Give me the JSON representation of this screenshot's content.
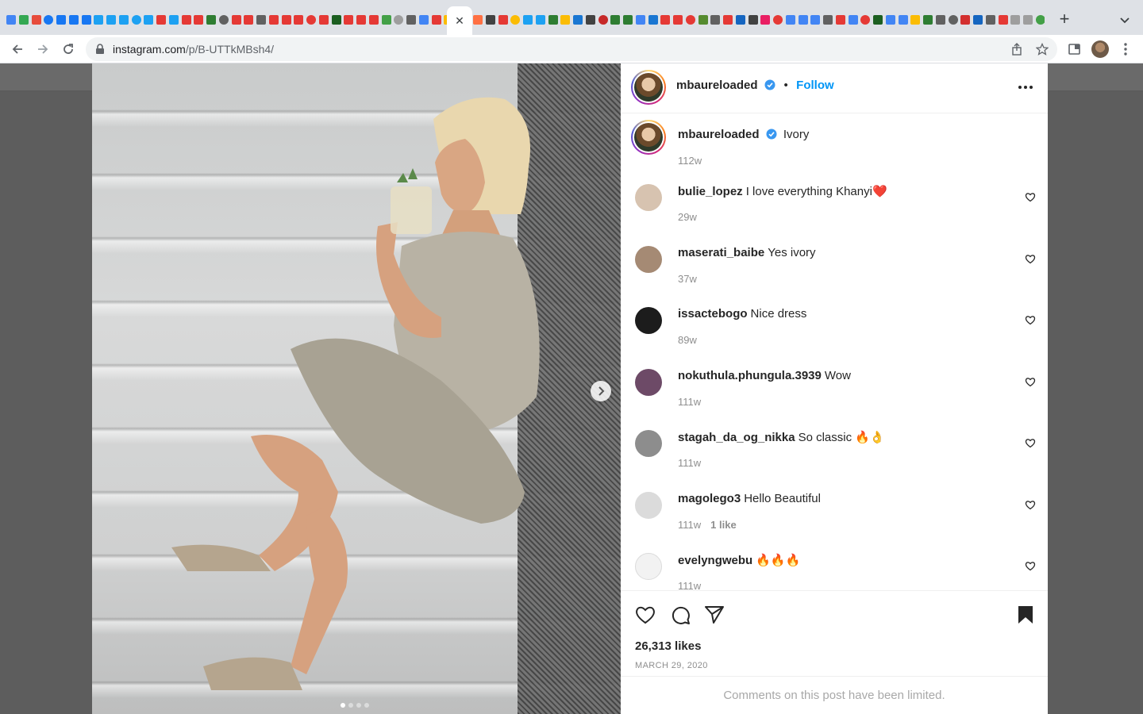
{
  "browser": {
    "favicon_colors": [
      "#4285f4",
      "#34a853",
      "#e74c3c",
      "#1877f2",
      "#1877f2",
      "#1877f2",
      "#1877f2",
      "#1da1f2",
      "#1da1f2",
      "#1da1f2",
      "#1da1f2",
      "#1da1f2",
      "#e53935",
      "#1da1f2",
      "#e53935",
      "#e53935",
      "#2e7d32",
      "#616161",
      "#e53935",
      "#e53935",
      "#616161",
      "#e53935",
      "#e53935",
      "#e53935",
      "#e53935",
      "#e53935",
      "#1b5e20",
      "#e53935",
      "#e53935",
      "#e53935",
      "#43a047",
      "#9e9e9e",
      "#616161",
      "#4285f4",
      "#e53935",
      "#fbbc04",
      "#1da1f2"
    ],
    "favicon_colors_right": [
      "#ff7043",
      "#424242",
      "#e53935",
      "#fbbc04",
      "#1da1f2",
      "#1da1f2",
      "#2e7d32",
      "#fbbc04",
      "#1976d2",
      "#424242",
      "#c62828",
      "#2e7d32",
      "#2e7d32",
      "#4285f4",
      "#1976d2",
      "#e53935",
      "#e53935",
      "#e53935",
      "#558b2f",
      "#616161",
      "#e53935",
      "#1565c0",
      "#424242",
      "#e91e63",
      "#e53935",
      "#4285f4",
      "#4285f4",
      "#4285f4",
      "#616161",
      "#e53935",
      "#4285f4",
      "#e53935",
      "#1b5e20",
      "#4285f4",
      "#4285f4",
      "#fbbc04",
      "#2e7d32",
      "#616161",
      "#616161",
      "#d32f2f",
      "#1565c0",
      "#616161",
      "#e53935",
      "#9e9e9e",
      "#9e9e9e",
      "#43a047",
      "#212121"
    ],
    "url_host": "instagram.com",
    "url_path": "/p/B-UTTkMBsh4/"
  },
  "post": {
    "author": "mbaureloaded",
    "follow_label": "Follow",
    "separator": "•",
    "caption": "Ivory",
    "caption_age": "112w",
    "likes": "26,313 likes",
    "date": "MARCH 29, 2020",
    "comments_limited": "Comments on this post have been limited.",
    "carousel_count": 4,
    "carousel_active": 0
  },
  "comments": [
    {
      "user": "bulie_lopez",
      "text": "I love everything Khanyi❤️",
      "age": "29w",
      "likes": "",
      "avatar_color": "#d7c3b0"
    },
    {
      "user": "maserati_baibe",
      "text": "Yes ivory",
      "age": "37w",
      "likes": "",
      "avatar_color": "#a58a74"
    },
    {
      "user": "issactebogo",
      "text": "Nice dress",
      "age": "89w",
      "likes": "",
      "avatar_color": "#1c1c1c"
    },
    {
      "user": "nokuthula.phungula.3939",
      "text": "Wow",
      "age": "111w",
      "likes": "",
      "avatar_color": "#6d4a67"
    },
    {
      "user": "stagah_da_og_nikka",
      "text": "So classic 🔥👌",
      "age": "111w",
      "likes": "",
      "avatar_color": "#8d8d8d"
    },
    {
      "user": "magolego3",
      "text": "Hello Beautiful",
      "age": "111w",
      "likes": "1 like",
      "avatar_color": "#dbdbdb"
    },
    {
      "user": "evelyngwebu",
      "text": "🔥🔥🔥",
      "age": "111w",
      "likes": "",
      "avatar_color": "#f2f2f2"
    }
  ],
  "colors": {
    "follow_blue": "#0095f6",
    "text_primary": "#262626",
    "text_secondary": "#8e8e8e"
  },
  "icons": [
    "lock-icon",
    "back-arrow-icon",
    "forward-arrow-icon",
    "reload-icon",
    "share-icon",
    "star-icon",
    "extensions-icon",
    "kebab-menu-icon",
    "verified-badge-icon",
    "heart-icon",
    "comment-icon",
    "share-plane-icon",
    "bookmark-icon",
    "chevron-right-icon"
  ]
}
